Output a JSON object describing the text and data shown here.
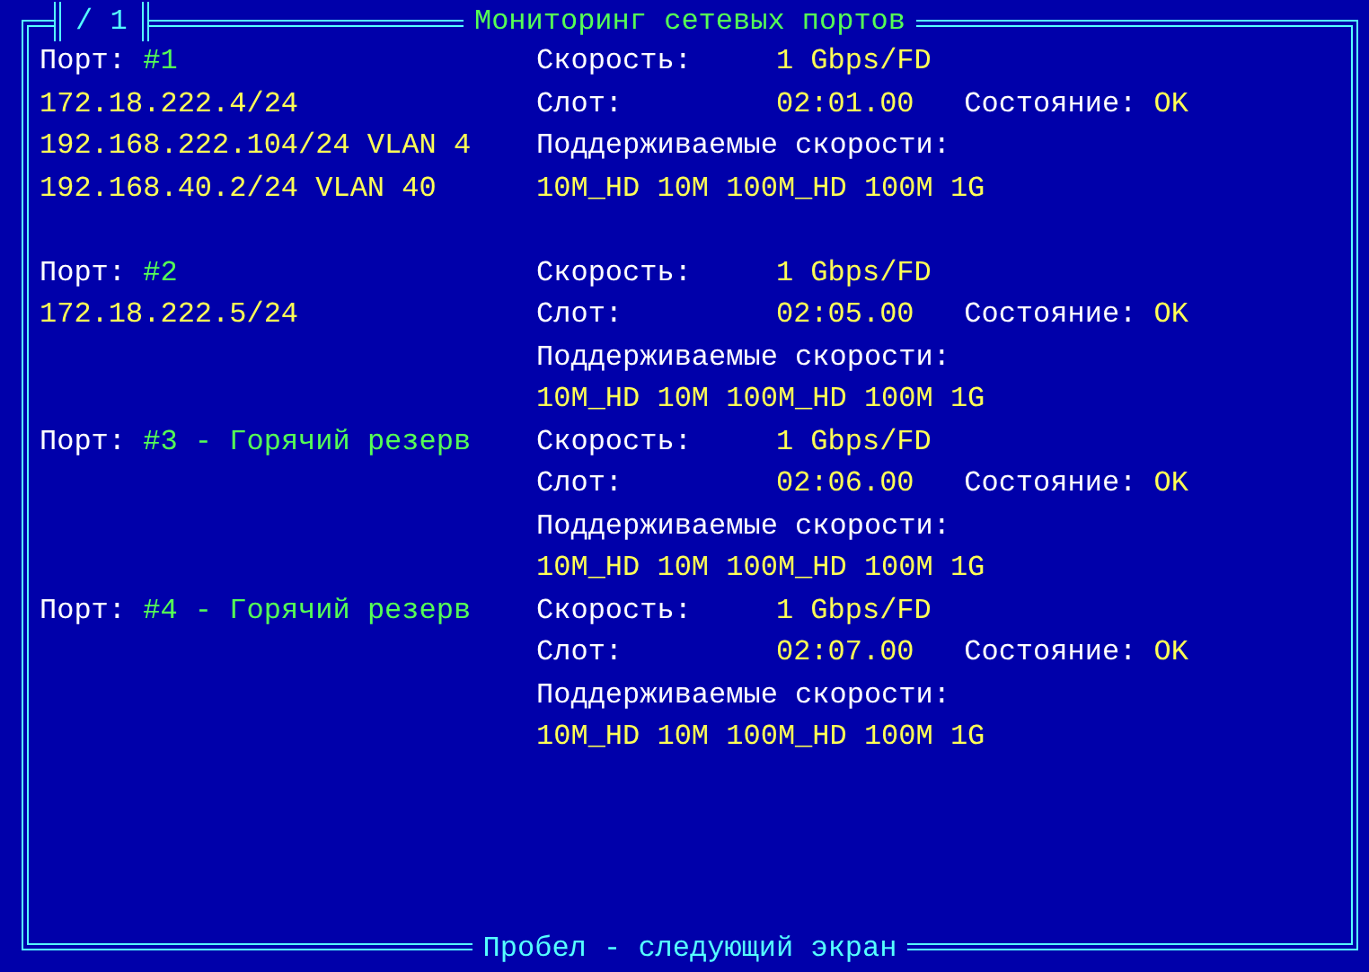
{
  "window": {
    "title": "Мониторинг сетевых портов",
    "page_indicator": "/ 1",
    "footer": "Пробел - следующий экран"
  },
  "ports": [
    {
      "label": "Порт:",
      "number": "#1",
      "addresses": [
        "172.18.222.4/24",
        "192.168.222.104/24 VLAN 4",
        "192.168.40.2/24 VLAN 40"
      ],
      "speed_label": "Скорость:",
      "speed": "1 Gbps/FD",
      "slot_label": "Слот:",
      "slot": "02:01.00",
      "state_label": "Состояние:",
      "state": "OK",
      "supported_label": "Поддерживаемые скорости:",
      "supported": "10M_HD 10M 100M_HD 100M 1G"
    },
    {
      "label": "Порт:",
      "number": "#2",
      "addresses": [
        "172.18.222.5/24"
      ],
      "speed_label": "Скорость:",
      "speed": "1 Gbps/FD",
      "slot_label": "Слот:",
      "slot": "02:05.00",
      "state_label": "Состояние:",
      "state": "OK",
      "supported_label": "Поддерживаемые скорости:",
      "supported": "10M_HD 10M 100M_HD 100M 1G"
    },
    {
      "label": "Порт:",
      "number": "#3 - Горячий резерв",
      "speed_label": "Скорость:",
      "speed": "1 Gbps/FD",
      "slot_label": "Слот:",
      "slot": "02:06.00",
      "state_label": "Состояние:",
      "state": "OK",
      "supported_label": "Поддерживаемые скорости:",
      "supported": "10M_HD 10M 100M_HD 100M 1G"
    },
    {
      "label": "Порт:",
      "number": "#4 - Горячий резерв",
      "speed_label": "Скорость:",
      "speed": "1 Gbps/FD",
      "slot_label": "Слот:",
      "slot": "02:07.00",
      "state_label": "Состояние:",
      "state": "OK",
      "supported_label": "Поддерживаемые скорости:",
      "supported": "10M_HD 10M 100M_HD 100M 1G"
    }
  ]
}
